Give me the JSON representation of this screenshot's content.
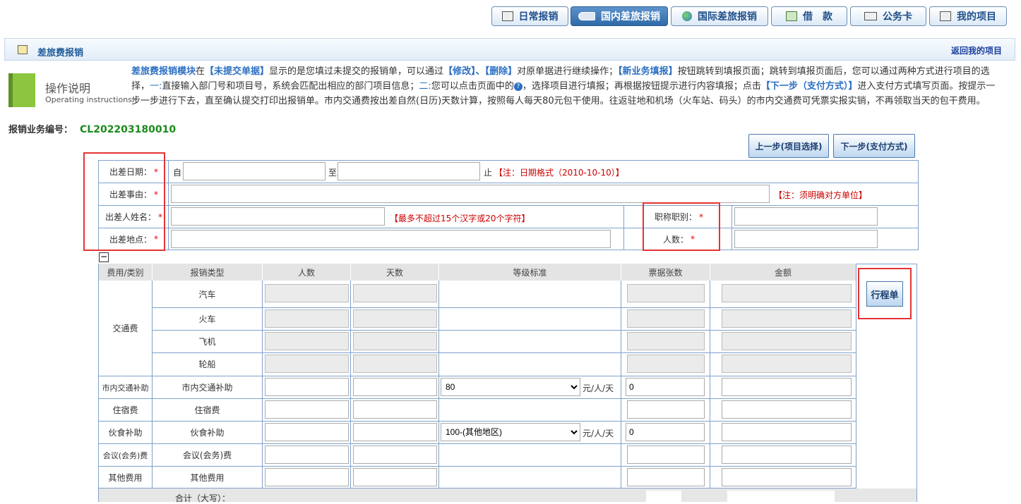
{
  "nav": {
    "daily": "日常报销",
    "domestic": "国内差旅报销",
    "international": "国际差旅报销",
    "loan": "借　款",
    "card": "公务卡",
    "projects": "我的项目"
  },
  "header": {
    "title": "差旅费报销",
    "back": "返回我的项目"
  },
  "help": {
    "title": "操作说明",
    "subtitle": "Operating instructions",
    "p1": "差旅费报销模块",
    "p2": "在",
    "p3": "【未提交单据】",
    "p4": "显示的是您填过未提交的报销单，可以通过",
    "p5": "【修改】、【删除】",
    "p6": "对原单据进行继续操作；",
    "p7": "【新业务填报】",
    "p8": "按钮跳转到填报页面；跳转到填报页面后，您可以通过两种方式进行项目的选择，",
    "p9": "一:",
    "p10": "直接输入部门号和项目号，系统会匹配出相应的部门项目信息；",
    "p11": "二:",
    "p12": "您可以点击页面中的",
    "p13": "，选择项目进行填报；再根据按钮提示进行内容填报；点击",
    "p14": "【下一步（支付方式）】",
    "p15": "进入支付方式填写页面。按提示一步一步进行下去，直至确认提交打印出报销单。市内交通费按出差自然(日历)天数计算，按照每人每天80元包干使用。往返驻地和机场（火车站、码头）的市内交通费可凭票实报实销，不再领取当天的包干费用。"
  },
  "business": {
    "label": "报销业务编号：",
    "value": "CL202203180010"
  },
  "steps": {
    "prev": "上一步(项目选择)",
    "next": "下一步(支付方式)"
  },
  "form": {
    "date_label": "出差日期：",
    "date_from": "自",
    "date_to": "至",
    "date_end": "止",
    "date_note": "【注：日期格式（2010-10-10）】",
    "reason_label": "出差事由：",
    "reason_note": "【注：须明确对方单位】",
    "name_label": "出差人姓名：",
    "name_note": "【最多不超过15个汉字或20个字符】",
    "title_label": "职称职别：",
    "place_label": "出差地点：",
    "count_label": "人数：",
    "star": "*"
  },
  "expense": {
    "headers": [
      "费用/类别",
      "报销类型",
      "人数",
      "天数",
      "等级标准",
      "票据张数",
      "金额"
    ],
    "transport": "交通费",
    "transport_types": [
      "汽车",
      "火车",
      "飞机",
      "轮船"
    ],
    "city_cat": "市内交通补助",
    "city_type": "市内交通补助",
    "city_std": "80",
    "city_unit": "元/人/天",
    "city_bills": "0",
    "lodging_cat": "住宿费",
    "lodging_type": "住宿费",
    "meal_cat": "伙食补助",
    "meal_type": "伙食补助",
    "meal_std": "100-(其他地区)",
    "meal_unit": "元/人/天",
    "meal_bills": "0",
    "meeting_cat": "会议(会务)费",
    "meeting_type": "会议(会务)费",
    "other_cat": "其他费用",
    "other_type": "其他费用",
    "total_label": "合计（大写）：",
    "trip_button": "行程单"
  }
}
